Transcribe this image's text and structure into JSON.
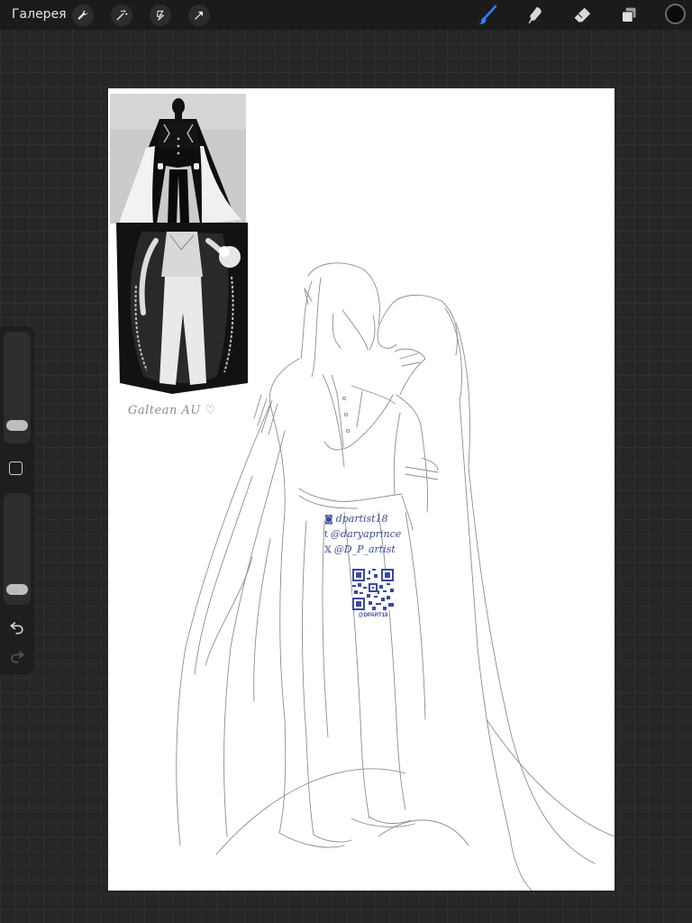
{
  "topbar": {
    "gallery_label": "Галерея",
    "left_tools": [
      "wrench-icon",
      "magic-wand-icon",
      "selection-icon",
      "transform-arrow-icon"
    ],
    "right_tools": [
      "brush-icon",
      "smudge-icon",
      "eraser-icon",
      "layers-icon"
    ],
    "active_tool": "brush-icon",
    "active_color": "#0b0b0b",
    "accent": "#2f7fff"
  },
  "sidebar": {
    "brush_size": 0.08,
    "brush_opacity": 0.05,
    "undo_icon": "undo-icon",
    "redo_icon": "redo-icon"
  },
  "canvas": {
    "signature": "Galtean AU ♡",
    "socials": [
      {
        "icon": "◙",
        "handle": "dpartist18"
      },
      {
        "icon": "t",
        "handle": "@daryaprince"
      },
      {
        "icon": "𝕏",
        "handle": "@D_P_artist"
      }
    ],
    "qr_caption": "@DPART18",
    "ink_color": "#3b4a9a"
  }
}
